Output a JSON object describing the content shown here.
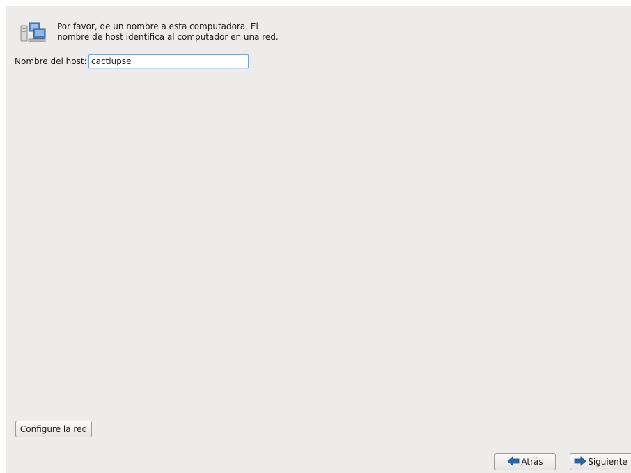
{
  "header": {
    "icon": "computer-network-icon",
    "line1": "Por favor, de un nombre a esta computadora. El",
    "line2": "nombre de host identifica al computador en una red."
  },
  "hostname": {
    "label": "Nombre del host:",
    "value": "cactiupse"
  },
  "buttons": {
    "configure": "Configure la red",
    "back": "Atrás",
    "back_icon": "arrow-left-icon",
    "next": "Siguiente",
    "next_icon": "arrow-right-icon"
  },
  "colors": {
    "background": "#edeceb",
    "arrow_blue": "#2a65a8"
  }
}
